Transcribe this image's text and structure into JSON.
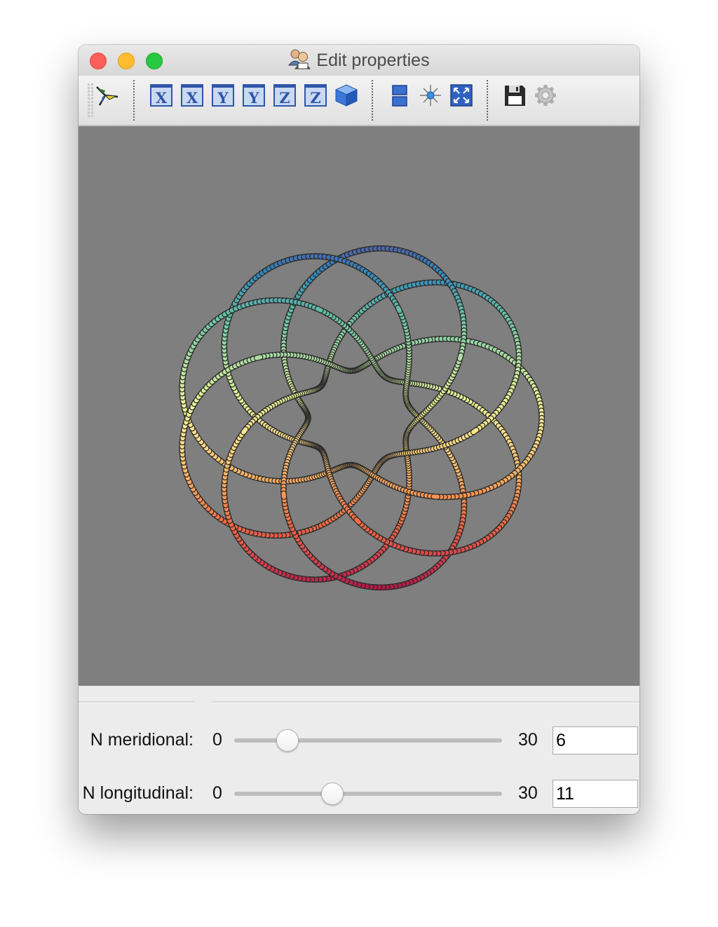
{
  "window": {
    "title": "Edit properties"
  },
  "toolbar": {
    "groups": [
      {
        "name": "mode",
        "items": [
          {
            "icon": "rotate-axes-icon"
          }
        ]
      },
      {
        "name": "views",
        "items": [
          {
            "icon": "view-x-icon",
            "letter": "X"
          },
          {
            "icon": "view-x-reverse-icon",
            "letter": "X"
          },
          {
            "icon": "view-y-icon",
            "letter": "Y"
          },
          {
            "icon": "view-y-reverse-icon",
            "letter": "Y"
          },
          {
            "icon": "view-z-icon",
            "letter": "Z"
          },
          {
            "icon": "view-z-reverse-icon",
            "letter": "Z"
          },
          {
            "icon": "cube-icon"
          }
        ]
      },
      {
        "name": "layout",
        "items": [
          {
            "icon": "split-view-icon"
          },
          {
            "icon": "center-icon"
          },
          {
            "icon": "fit-to-view-icon"
          }
        ]
      },
      {
        "name": "file",
        "items": [
          {
            "icon": "save-icon"
          },
          {
            "icon": "settings-gear-icon"
          }
        ]
      }
    ]
  },
  "viewport": {
    "background": "#7f7f7f",
    "figure": "torus-knot-tube",
    "colormap": [
      "#5e4fa2",
      "#3288bd",
      "#66c2a5",
      "#abdda4",
      "#e6f598",
      "#fee08b",
      "#fdae61",
      "#f46d43",
      "#d53e4f",
      "#9e0142"
    ]
  },
  "controls": {
    "meridional": {
      "label": "N meridional:",
      "min": "0",
      "max": "30",
      "value": "6"
    },
    "longitudinal": {
      "label": "N longitudinal:",
      "min": "0",
      "max": "30",
      "value": "11"
    }
  }
}
